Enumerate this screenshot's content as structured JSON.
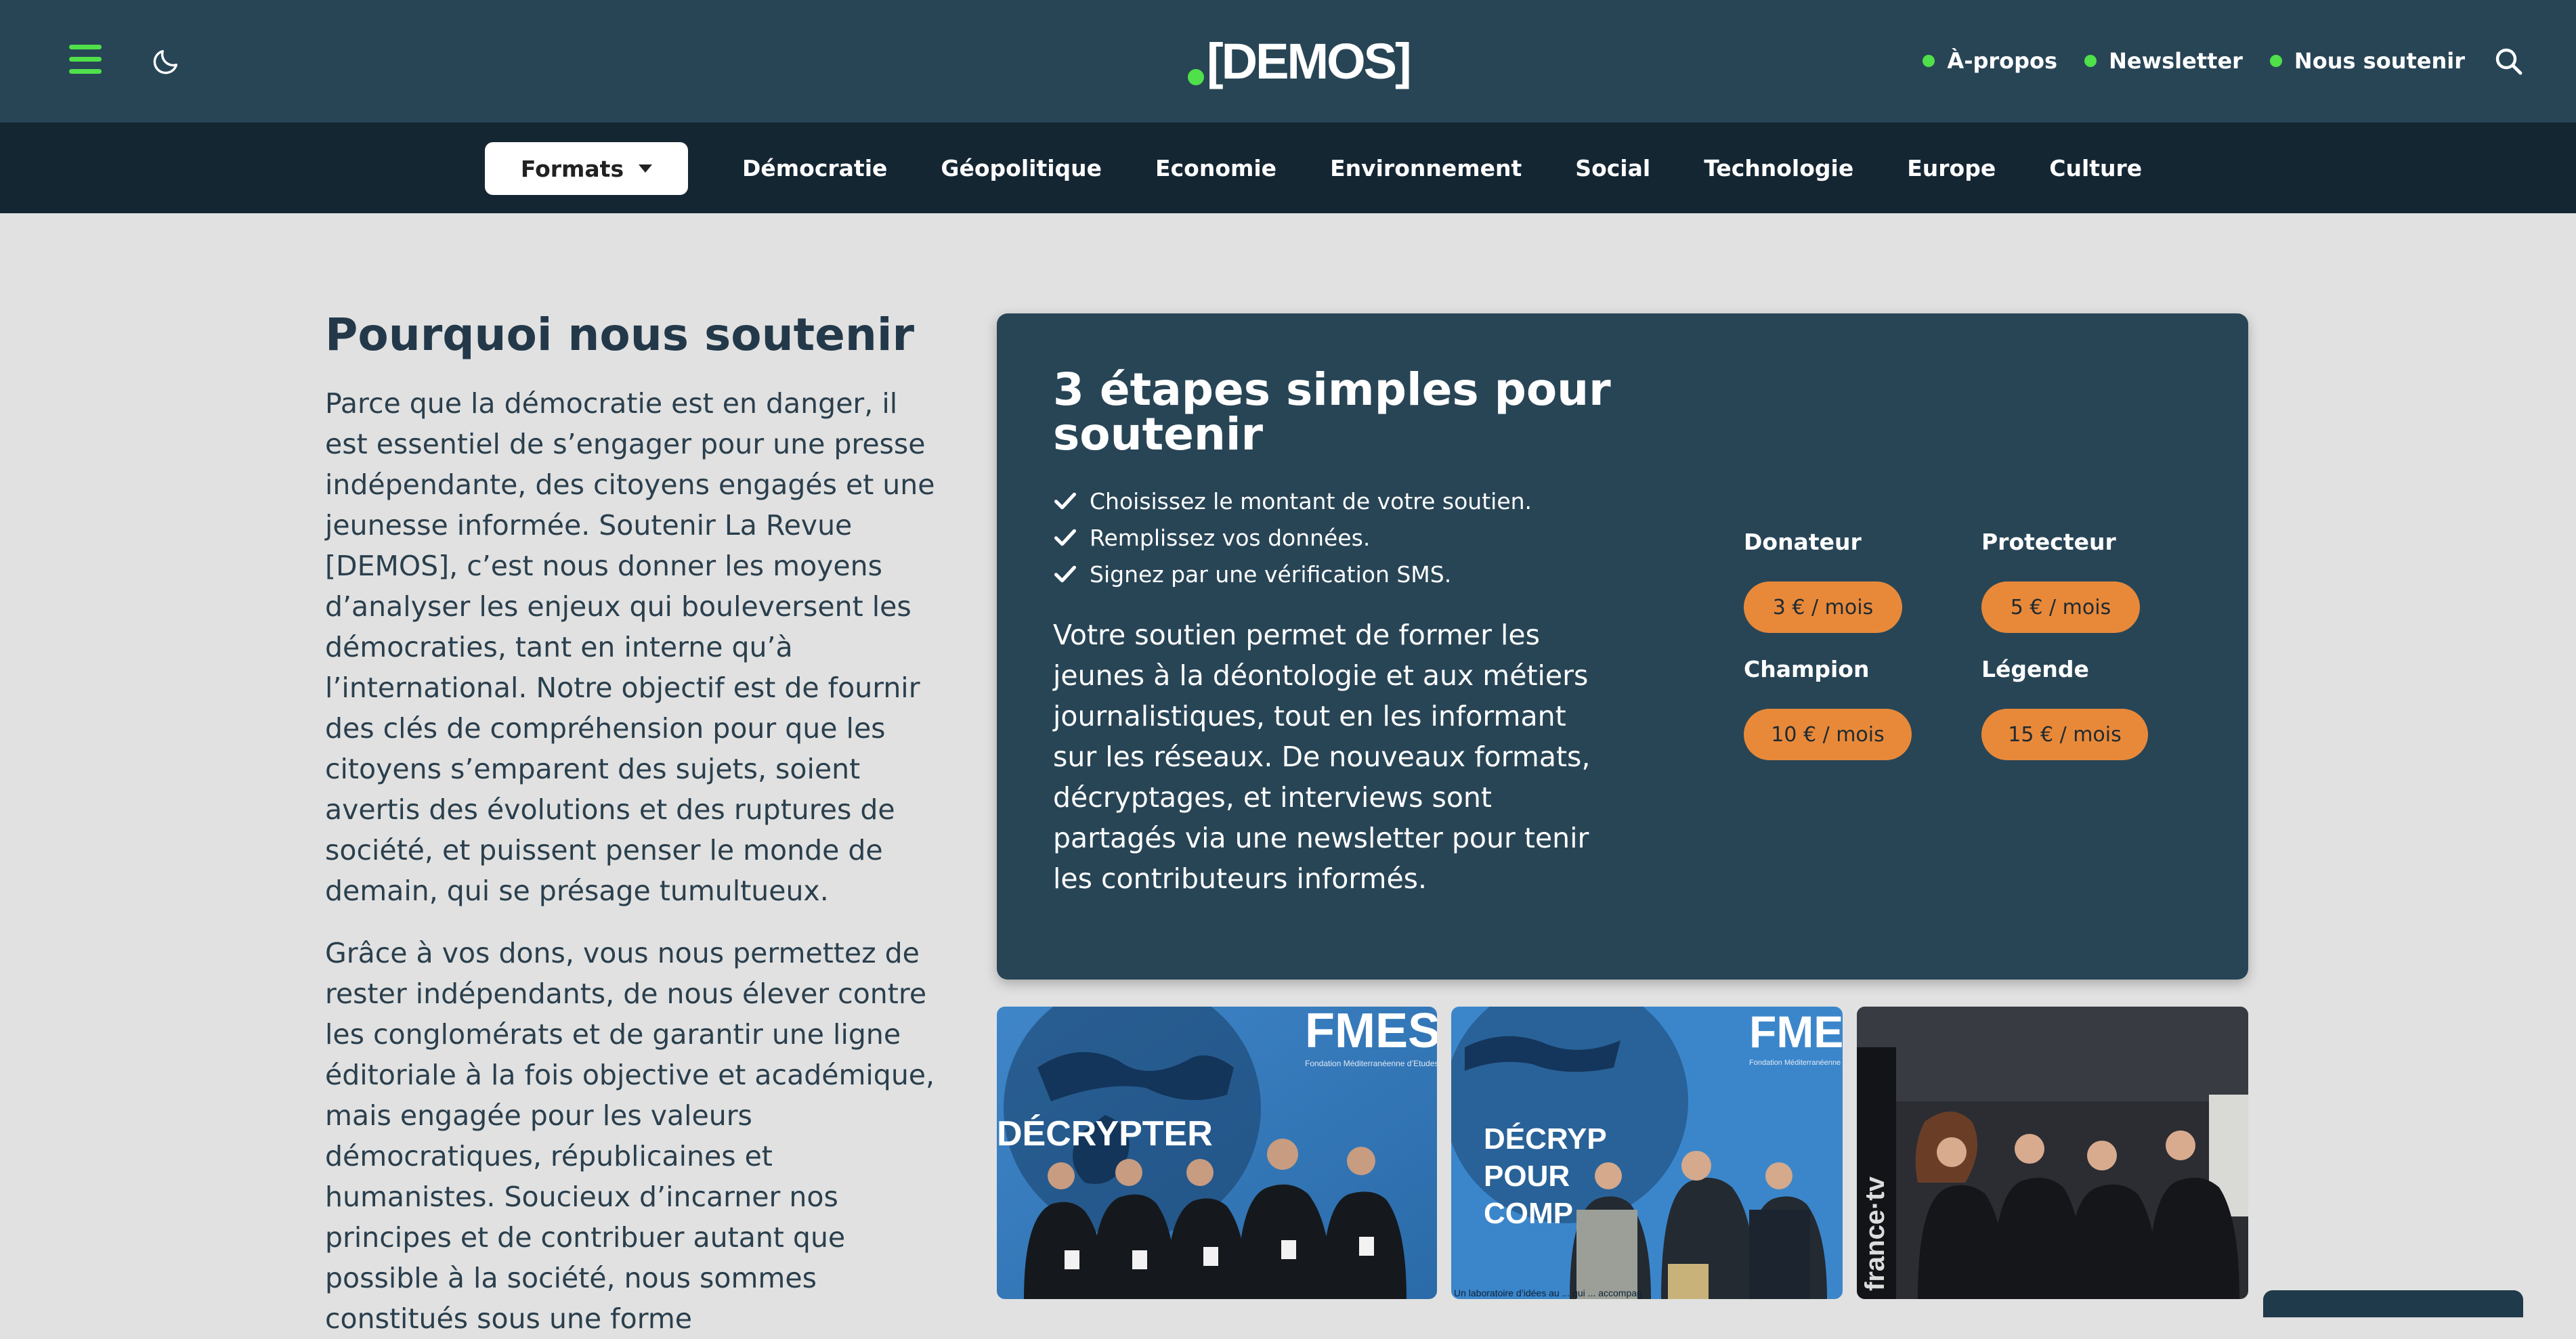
{
  "brand": {
    "logo": "[DEMOS]",
    "accent": "#4fe04a",
    "header_bg": "#284556",
    "nav_bg": "#152633",
    "page_bg": "#e1e1e1",
    "button_orange": "#e8893a"
  },
  "header": {
    "icons": [
      "menu-icon",
      "moon-icon",
      "search-icon"
    ],
    "links": [
      "À-propos",
      "Newsletter",
      "Nous soutenir"
    ]
  },
  "categories": {
    "formats_label": "Formats",
    "items": [
      "Démocratie",
      "Géopolitique",
      "Economie",
      "Environnement",
      "Social",
      "Technologie",
      "Europe",
      "Culture"
    ]
  },
  "left": {
    "title": "Pourquoi nous soutenir",
    "paragraphs": [
      "Parce que la démocratie est en danger, il est essentiel de s’engager pour une presse indépendante, des citoyens engagés et une jeunesse informée. Soutenir La Revue [DEMOS], c’est nous donner les moyens d’analyser les enjeux qui bouleversent les démocraties, tant en interne qu’à l’international. Notre objectif est de fournir des clés de compréhension pour que les citoyens s’emparent des sujets, soient avertis des évolutions et des ruptures de société, et puissent penser le monde de demain, qui se présage tumultueux.",
      "Grâce à vos dons, vous nous permettez de rester indépendants, de nous élever contre les conglomérats et de garantir une ligne éditoriale à la fois objective et académique, mais engagée pour les valeurs démocratiques, républicaines et humanistes. Soucieux d’incarner nos principes et de contribuer autant que possible à la société, nous sommes constitués sous une forme"
    ]
  },
  "card": {
    "title": "3 étapes simples pour soutenir",
    "steps": [
      "Choisissez le montant de votre soutien.",
      "Remplissez vos données.",
      "Signez par une vérification SMS."
    ],
    "description": "Votre soutien permet de former les jeunes à la déontologie et aux métiers journalistiques, tout en les informant sur les réseaux. De nouveaux formats, décryptages, et interviews sont partagés via une newsletter pour tenir les contributeurs informés.",
    "tiers": [
      {
        "name": "Donateur",
        "price": "3 € / mois"
      },
      {
        "name": "Protecteur",
        "price": "5 € / mois"
      },
      {
        "name": "Champion",
        "price": "10 € / mois"
      },
      {
        "name": "Légende",
        "price": "15 € / mois"
      }
    ]
  },
  "photos": {
    "ph1": {
      "banner": "FMES",
      "sub": "Fondation Méditerranéenne d’Etudes Stratégiques",
      "big": "DÉCRYPTER"
    },
    "ph2": {
      "banner": "FMES",
      "sub": "Fondation Méditerranéenne d’Etudes Stratégiques",
      "big1": "DÉCRYP",
      "big2": "POUR",
      "big3": "COMP",
      "caption": "Un laboratoire d’idées au ... qui ... accompag"
    },
    "ph3": {
      "vertical": "france·tv"
    }
  }
}
